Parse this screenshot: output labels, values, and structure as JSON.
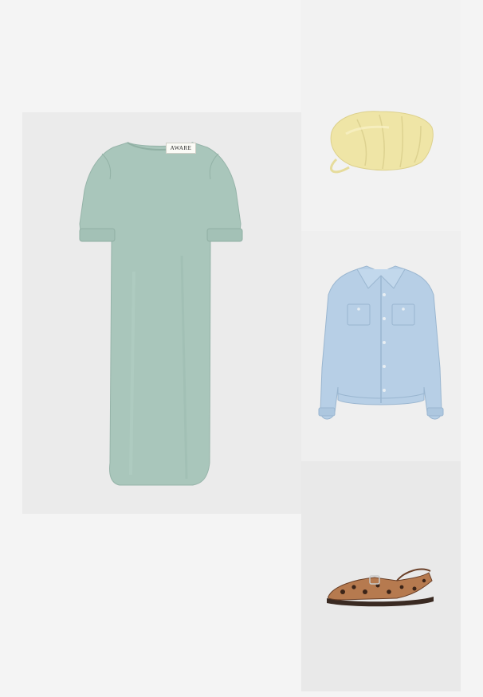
{
  "outfit": {
    "items": [
      {
        "id": "dress",
        "name": "dress-image",
        "brand_label": "AWARE"
      },
      {
        "id": "bag",
        "name": "pouch-bag-image"
      },
      {
        "id": "jacket",
        "name": "denim-jacket-image"
      },
      {
        "id": "shoe",
        "name": "leopard-slingback-image"
      }
    ]
  },
  "colors": {
    "background": "#f4f4f4",
    "dress": "#a9c6bb",
    "bag": "#efe5a6",
    "jacket": "#b7cfe6",
    "shoe_base": "#b67a4f"
  }
}
